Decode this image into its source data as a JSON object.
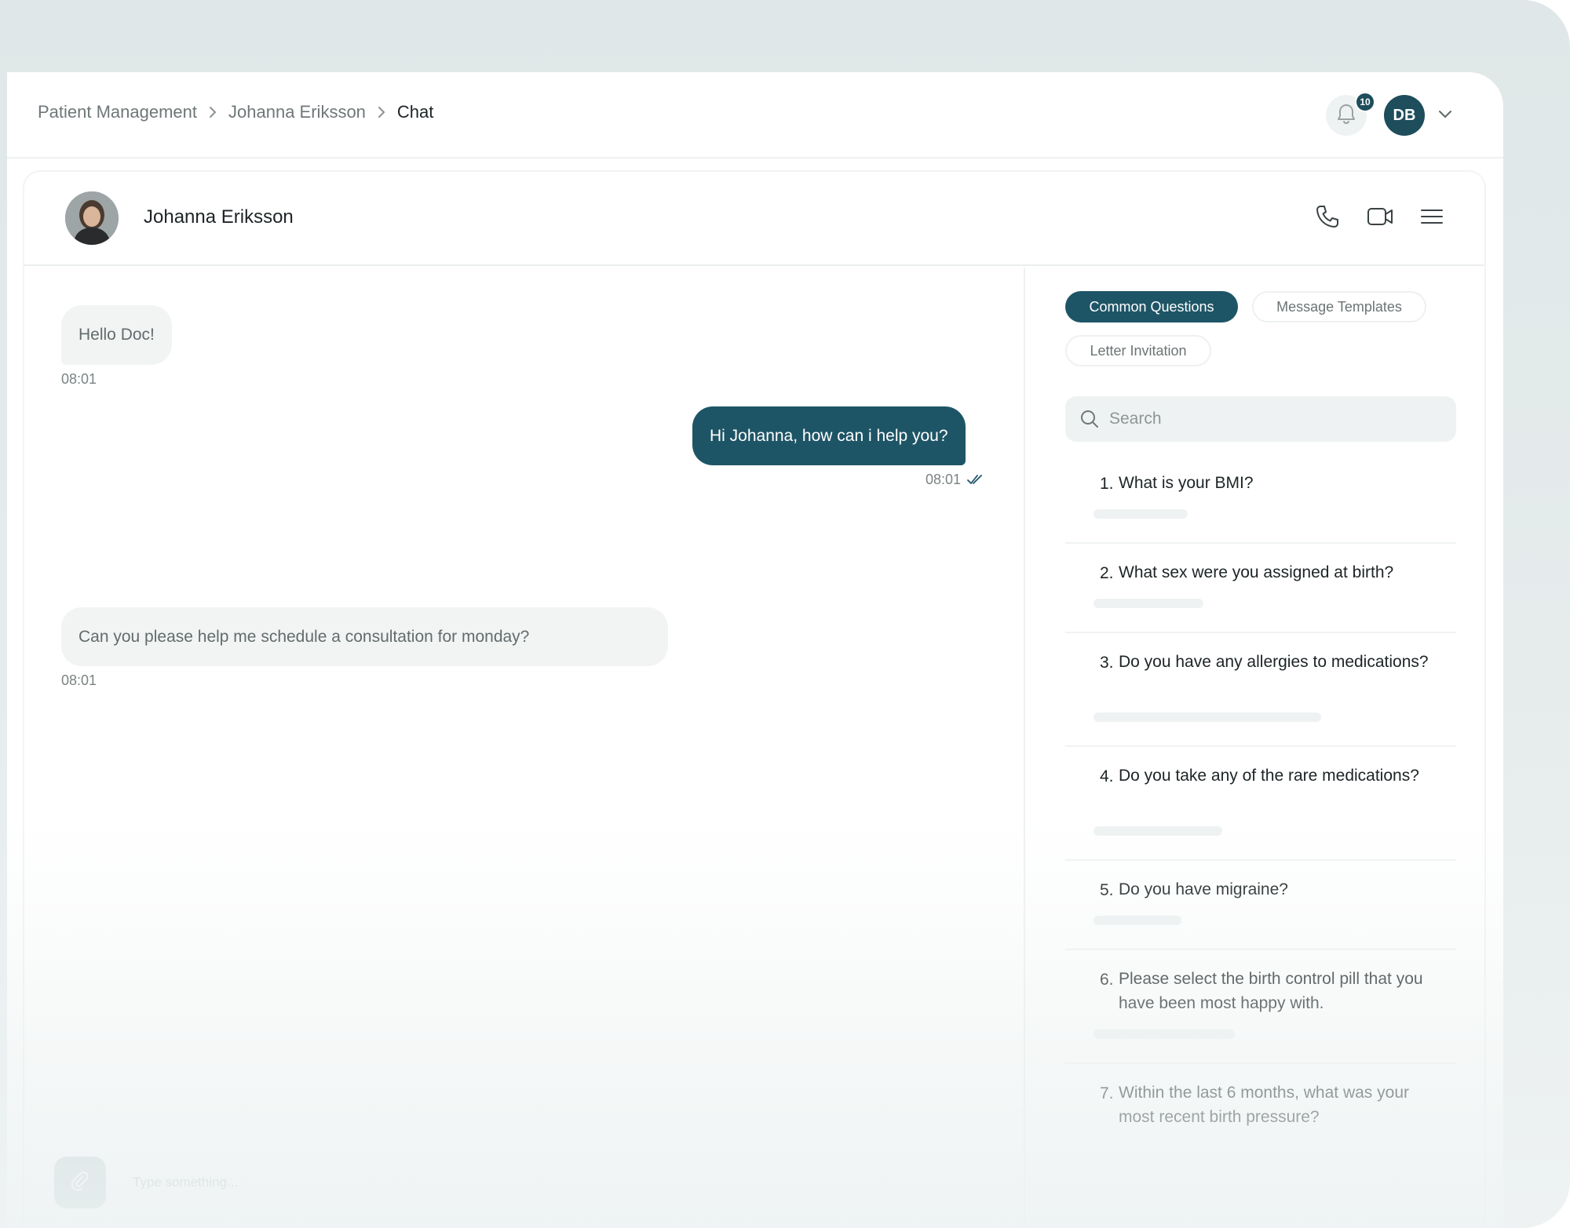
{
  "breadcrumb": {
    "items": [
      "Patient Management",
      "Johanna Eriksson"
    ],
    "current": "Chat"
  },
  "notifications": {
    "count": "10",
    "icon": "bell-icon"
  },
  "user": {
    "initials": "DB"
  },
  "chat": {
    "patient_name": "Johanna Eriksson",
    "messages": [
      {
        "direction": "incoming",
        "text": "Hello Doc!",
        "time": "08:01"
      },
      {
        "direction": "outgoing",
        "text": "Hi Johanna, how can i help you?",
        "time": "08:01",
        "status": "read"
      },
      {
        "direction": "incoming",
        "text": "Can you please help me schedule a consultation for monday?",
        "time": "08:01"
      }
    ],
    "composer": {
      "placeholder": "Type something..."
    }
  },
  "side_panel": {
    "tabs": [
      {
        "label": "Common Questions",
        "active": true
      },
      {
        "label": "Message Templates",
        "active": false
      },
      {
        "label": "Letter Invitation",
        "active": false
      }
    ],
    "search": {
      "placeholder": "Search"
    },
    "questions": [
      {
        "num": "1.",
        "text": "What is your BMI?"
      },
      {
        "num": "2.",
        "text": "What sex were you assigned at birth?"
      },
      {
        "num": "3.",
        "text": "Do you have any allergies to medications?"
      },
      {
        "num": "4.",
        "text": "Do you take any of the rare medications?"
      },
      {
        "num": "5.",
        "text": "Do you have migraine?"
      },
      {
        "num": "6.",
        "text": "Please select the birth control pill that you have been most happy with."
      },
      {
        "num": "7.",
        "text": "Within the last 6 months, what was your most recent birth pressure?"
      }
    ]
  },
  "colors": {
    "accent": "#1e5566",
    "bubble_in": "#f2f4f4",
    "background": "#dfe7e8"
  }
}
